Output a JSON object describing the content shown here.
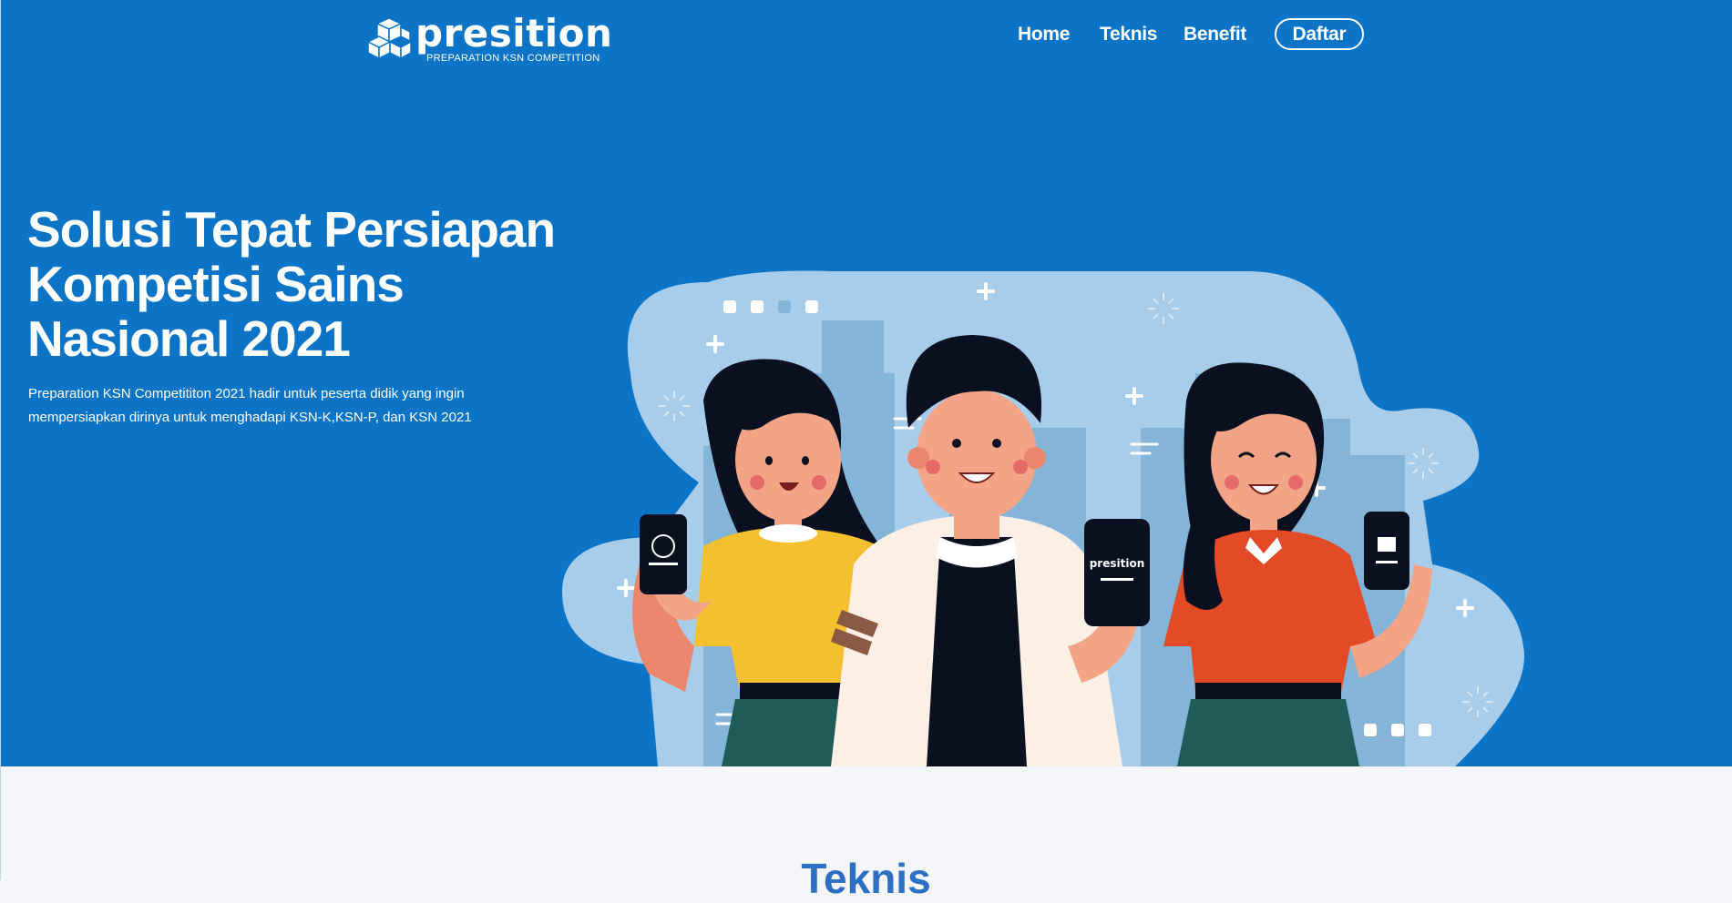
{
  "brand": {
    "name": "presition",
    "tagline": "PREPARATION KSN COMPETITION"
  },
  "nav": {
    "items": [
      {
        "label": "Home"
      },
      {
        "label": "Teknis"
      },
      {
        "label": "Benefit"
      }
    ],
    "cta_label": "Daftar"
  },
  "hero": {
    "title": "Solusi Tepat Persiapan Kompetisi Sains Nasional 2021",
    "description": "Preparation KSN Competititon 2021 hadir untuk peserta didik yang ingin mempersiapkan dirinya untuk menghadapi KSN-K,KSN-P, dan KSN 2021",
    "phone_brand": "presition"
  },
  "section": {
    "title": "Teknis"
  },
  "colors": {
    "hero_bg": "#0b74c7",
    "page_bg": "#f4f6f9",
    "section_title": "#2d6fc2",
    "blob": "#a8cdeb",
    "city": "#84b4d8"
  }
}
